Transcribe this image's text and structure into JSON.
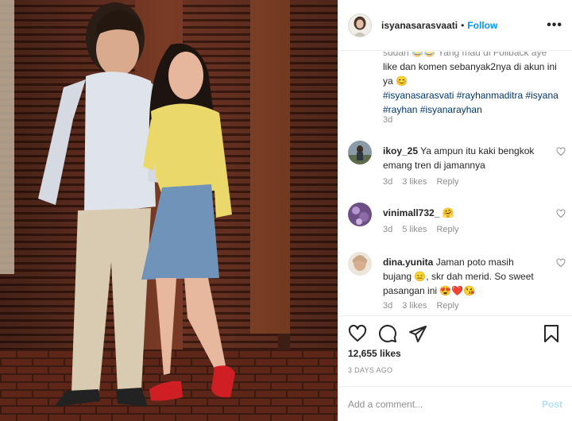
{
  "post": {
    "photo_alt": "Two people standing in front of wooden shutters"
  },
  "header": {
    "username": "isyanasarasvaati",
    "separator": "•",
    "follow_label": "Follow",
    "more_label": "•••"
  },
  "caption": {
    "partial_line": "sudah 😂😂 Yang mau di Follback aye",
    "text": "like dan komen sebanyak2nya di akun ini ya 😊",
    "hashtags": [
      "#isyanasarasvati",
      "#rayhanmaditra",
      "#isyana",
      "#rayhan",
      "#isyanarayhan"
    ],
    "time": "3d"
  },
  "comments": [
    {
      "username": "ikoy_25",
      "text": "Ya ampun itu kaki bengkok emang tren di jamannya",
      "time": "3d",
      "likes": "3 likes",
      "reply_label": "Reply"
    },
    {
      "username": "vinimall732_",
      "text": "🤗",
      "time": "3d",
      "likes": "5 likes",
      "reply_label": "Reply"
    },
    {
      "username": "dina.yunita",
      "text": "Jaman poto masih bujang 😑, skr dah merid. So sweet pasangan ini 😍❤️😘",
      "time": "3d",
      "likes": "3 likes",
      "reply_label": "Reply"
    }
  ],
  "actions": {
    "like_icon": "heart-icon",
    "comment_icon": "comment-icon",
    "share_icon": "share-icon",
    "save_icon": "bookmark-icon",
    "likes_count": "12,655 likes",
    "date": "3 DAYS AGO"
  },
  "add_comment": {
    "placeholder": "Add a comment...",
    "post_label": "Post"
  },
  "colors": {
    "link_blue": "#0095f6",
    "hashtag_blue": "#00376b",
    "muted": "#8e8e8e",
    "post_disabled": "#b2dffc"
  }
}
